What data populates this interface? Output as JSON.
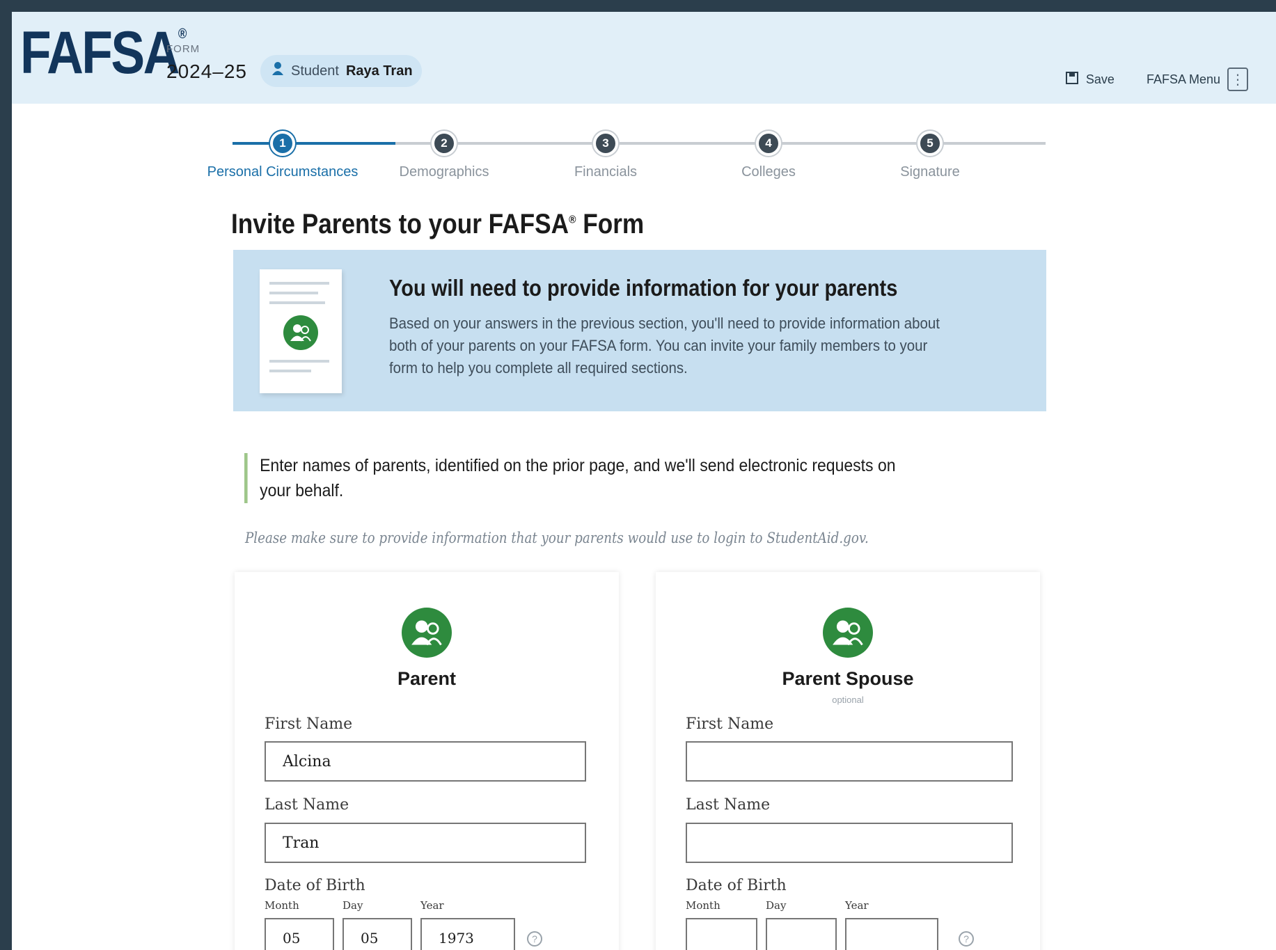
{
  "header": {
    "logo": "FAFSA",
    "logo_mark": "®",
    "form_word": "FORM",
    "form_year": "2024–25",
    "student_prefix": "Student",
    "student_name": "Raya Tran",
    "save_label": "Save",
    "menu_label": "FAFSA Menu",
    "menu_icon_glyph": "⋮"
  },
  "stepper": {
    "steps": [
      {
        "number": "1",
        "label": "Personal Circumstances"
      },
      {
        "number": "2",
        "label": "Demographics"
      },
      {
        "number": "3",
        "label": "Financials"
      },
      {
        "number": "4",
        "label": "Colleges"
      },
      {
        "number": "5",
        "label": "Signature"
      }
    ],
    "active_step": 1
  },
  "page": {
    "title": "Invite Parents to your FAFSA",
    "title_mark": "®",
    "title_suffix": " Form"
  },
  "info_card": {
    "title": "You will need to provide information for your parents",
    "body": "Based on your answers in the previous section, you'll need to provide information about both of your parents on your FAFSA form. You can invite your family members to your form to help you complete all required sections."
  },
  "instruction": "Enter names of parents, identified on the prior page, and we'll send electronic requests on your behalf.",
  "note": "Please make sure to provide information that your parents would use to login to StudentAid.gov.",
  "parents": [
    {
      "title": "Parent",
      "subtitle": "",
      "first_name_label": "First Name",
      "first_name_value": "Alcina",
      "last_name_label": "Last Name",
      "last_name_value": "Tran",
      "dob_label": "Date of Birth",
      "month_label": "Month",
      "day_label": "Day",
      "year_label": "Year",
      "month_value": "05",
      "day_value": "05",
      "year_value": "1973"
    },
    {
      "title": "Parent Spouse",
      "subtitle": "optional",
      "first_name_label": "First Name",
      "first_name_value": "",
      "last_name_label": "Last Name",
      "last_name_value": "",
      "dob_label": "Date of Birth",
      "month_label": "Month",
      "day_label": "Day",
      "year_label": "Year",
      "month_value": "",
      "day_value": "",
      "year_value": ""
    }
  ],
  "help_glyph": "?",
  "colors": {
    "brand_navy": "#12355b",
    "header_bg": "#e1eff8",
    "active_blue": "#1a6fa8",
    "info_bg": "#c7dff0",
    "icon_green": "#2e8b3e",
    "border_green": "#9ec68a"
  }
}
